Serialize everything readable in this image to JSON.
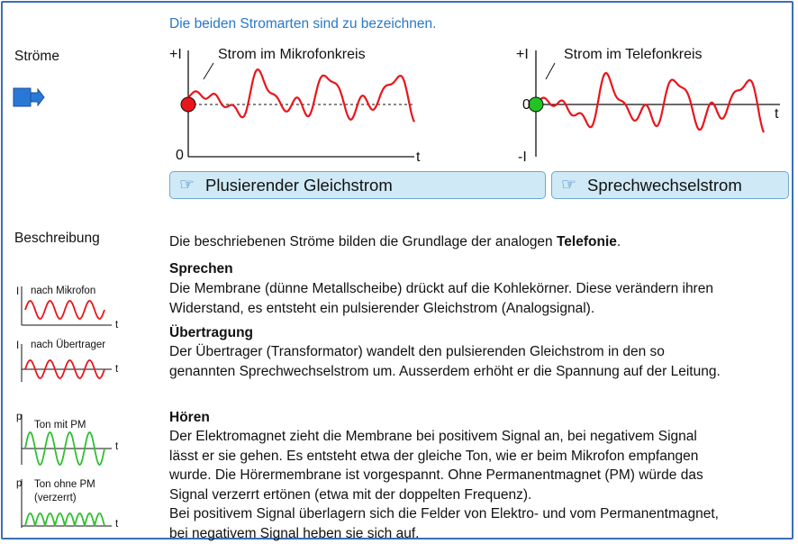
{
  "instruction": "Die beiden Stromarten sind zu bezeichnen.",
  "sections": {
    "stroeme": "Ströme",
    "beschreibung": "Beschreibung"
  },
  "graph_left": {
    "label": "Strom im Mikrofonkreis",
    "y_top": "+I",
    "y_zero": "0",
    "x_label": "t",
    "marker_color": "#e8161b"
  },
  "graph_right": {
    "label": "Strom im Telefonkreis",
    "y_top": "+I",
    "y_zero": "0",
    "y_bottom": "-I",
    "x_label": "t",
    "marker_color": "#22c322"
  },
  "answers": {
    "left": "Plusierender Gleichstrom",
    "right": "Sprechwechselstrom"
  },
  "intro": {
    "text": "Die beschriebenen Ströme bilden die Grundlage der analogen ",
    "bold": "Telefonie",
    "end": "."
  },
  "sprechen": {
    "title": "Sprechen",
    "line1": "Die Membrane (dünne Metallscheibe) drückt auf die Kohlekörner. Diese verändern ihren",
    "line2": "Widerstand, es entsteht ein pulsierender Gleichstrom (Analogsignal)."
  },
  "uebertragung": {
    "title": "Übertragung",
    "line1": "Der Übertrager (Transformator) wandelt den pulsierenden Gleichstrom in den so",
    "line2": "genannten Sprechwechselstrom um. Ausserdem erhöht er die Spannung auf der Leitung."
  },
  "hoeren": {
    "title": "Hören",
    "line1": "Der Elektromagnet zieht die Membrane bei positivem Signal an, bei negativem Signal",
    "line2": "lässt er sie gehen. Es entsteht etwa der gleiche Ton, wie er beim Mikrofon empfangen",
    "line3": "wurde. Die Hörermembrane ist vorgespannt. Ohne Permanentmagnet (PM) würde das",
    "line4": "Signal verzerrt ertönen (etwa mit der doppelten Frequenz).",
    "line5": "Bei positivem Signal überlagern sich die Felder von Elektro- und vom Permanentmagnet,",
    "line6": "bei negativem Signal heben sie sich auf."
  },
  "mini_graphs": [
    {
      "y": "I",
      "label": "nach Mikrofon",
      "x": "t",
      "color": "#e8161b"
    },
    {
      "y": "I",
      "label": "nach Übertrager",
      "x": "t",
      "color": "#e8161b"
    },
    {
      "y": "p",
      "label": "Ton mit PM",
      "x": "t",
      "color": "#2fbf2f"
    },
    {
      "y": "p",
      "label": "Ton ohne PM",
      "label2": "(verzerrt)",
      "x": "t",
      "color": "#2fbf2f"
    }
  ],
  "colors": {
    "frame": "#3a6fb5",
    "accent_text": "#2878c8",
    "answer_bg": "#cfe9f6",
    "signal_red": "#e8161b",
    "signal_green": "#2fbf2f"
  }
}
